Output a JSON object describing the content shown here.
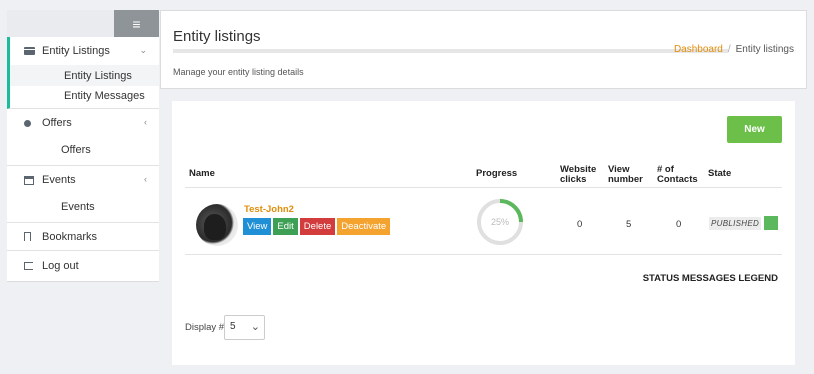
{
  "sidebar": {
    "menu_icon": "≡",
    "items": [
      {
        "label": "Entity Listings",
        "icon": "card-icon",
        "expanded": true,
        "subitems": [
          {
            "label": "Entity Listings",
            "selected": true
          },
          {
            "label": "Entity Messages",
            "selected": false
          }
        ]
      },
      {
        "label": "Offers",
        "icon": "dot-icon",
        "subitems": [
          {
            "label": "Offers"
          }
        ]
      },
      {
        "label": "Events",
        "icon": "calendar-icon",
        "subitems": [
          {
            "label": "Events"
          }
        ]
      },
      {
        "label": "Bookmarks",
        "icon": "bookmark-icon"
      },
      {
        "label": "Log out",
        "icon": "logout-icon"
      }
    ]
  },
  "header": {
    "title": "Entity listings",
    "breadcrumb": {
      "home": "Dashboard",
      "separator": "/",
      "current": "Entity listings"
    },
    "description": "Manage your entity listing details"
  },
  "main": {
    "new_button": "New",
    "columns": {
      "name": "Name",
      "progress": "Progress",
      "website_clicks_1": "Website",
      "website_clicks_2": "clicks",
      "view_number_1": "View",
      "view_number_2": "number",
      "contacts_1": "# of",
      "contacts_2": "Contacts",
      "state": "State"
    },
    "row": {
      "name": "Test-John2",
      "actions": {
        "view": "View",
        "edit": "Edit",
        "delete": "Delete",
        "deactivate": "Deactivate"
      },
      "progress_label": "25%",
      "progress_value": 0.25,
      "website_clicks": "0",
      "view_number": "5",
      "contacts": "0",
      "state": "PUBLISHED"
    },
    "legend_title": "STATUS MESSAGES LEGEND",
    "display_label": "Display #",
    "display_value": "5"
  },
  "colors": {
    "accent_orange": "#e08e0b",
    "active_border": "#1abc9c",
    "new_button": "#6cc04a",
    "published": "#5cb85c"
  }
}
